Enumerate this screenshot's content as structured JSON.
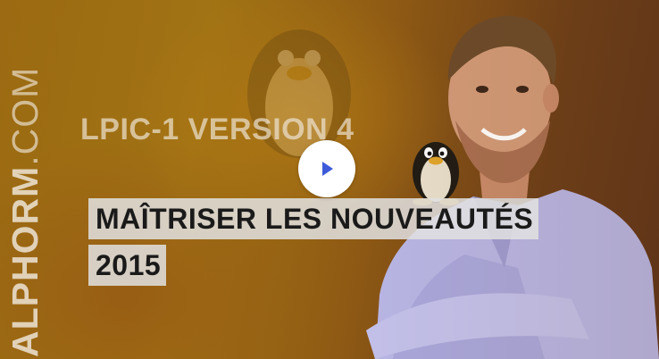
{
  "brand": {
    "name_bold": "ALPHORM",
    "name_rest": ".COM"
  },
  "course": {
    "version_label": "LPIC-1 VERSION 4",
    "title_line1": "MAÎTRISER LES NOUVEAUTÉS",
    "title_line2": "2015"
  },
  "player": {
    "play_icon": "play-icon",
    "play_color": "#3d5bd9"
  },
  "colors": {
    "background": "#9a6a12",
    "title_bar": "#e1e1e1",
    "title_text": "#1a1a1a"
  }
}
